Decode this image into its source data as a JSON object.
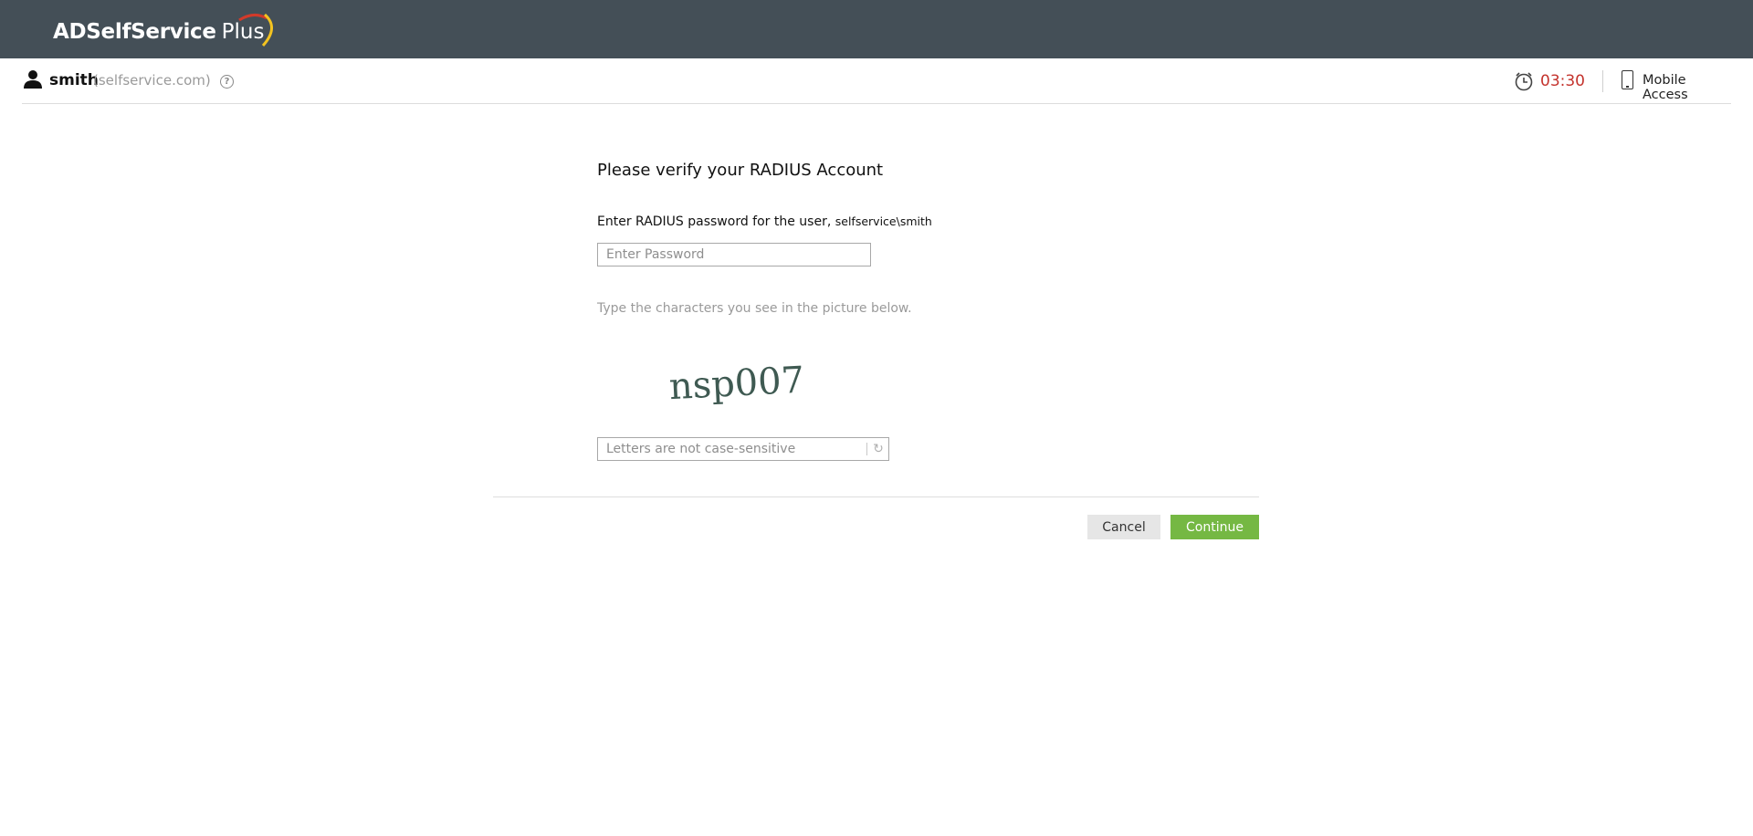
{
  "header": {
    "logo_main": "ADSelfService",
    "logo_plus": "Plus",
    "brand_colors": {
      "bar": "#444f57",
      "arc_red": "#d23a2a",
      "arc_yellow": "#f3c320"
    }
  },
  "userbar": {
    "username": "smith",
    "domain": "(selfservice.com)",
    "help_icon": "help-circle-icon",
    "timer": "03:30",
    "timer_color": "#c4332d",
    "mobile_access": "Mobile Access"
  },
  "form": {
    "title": "Please verify your RADIUS Account",
    "password_label": "Enter RADIUS password for the user,",
    "password_user": "selfservice\\smith",
    "password_placeholder": "Enter Password",
    "captcha_hint": "Type the characters you see in the picture below.",
    "captcha_text": "nsp007",
    "captcha_placeholder": "Letters are not case-sensitive",
    "refresh_icon": "refresh-icon"
  },
  "actions": {
    "cancel": "Cancel",
    "continue": "Continue",
    "continue_color": "#75b843"
  }
}
